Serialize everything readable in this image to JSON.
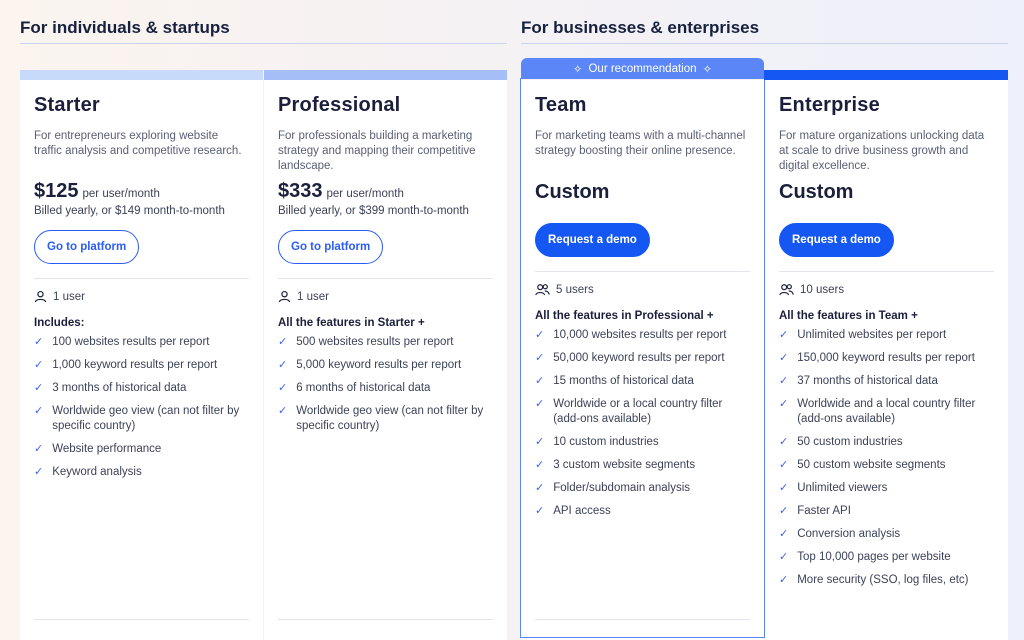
{
  "groups": {
    "individuals": "For individuals & startups",
    "businesses": "For businesses & enterprises"
  },
  "recommendation": "Our recommendation",
  "colors": {
    "accent": "#1557f2",
    "starter_bar": "#c8daf9",
    "professional_bar": "#a6bef7",
    "team_bar": "#5b86f7",
    "enterprise_bar": "#1557f2"
  },
  "plans": [
    {
      "name": "Starter",
      "description": "For entrepreneurs exploring website traffic analysis and competitive research.",
      "price": "$125",
      "price_unit": "per user/month",
      "billing": "Billed yearly, or $149 month-to-month",
      "button": "Go to platform",
      "users_icon": "user-icon",
      "users": "1 user",
      "includes": "Includes:",
      "features": [
        "100 websites results per report",
        "1,000 keyword results per report",
        "3 months of historical data",
        "Worldwide geo view (can not filter by specific country)",
        "Website performance",
        "Keyword analysis"
      ]
    },
    {
      "name": "Professional",
      "description": "For professionals building a marketing strategy and mapping their competitive landscape.",
      "price": "$333",
      "price_unit": "per user/month",
      "billing": "Billed yearly, or $399 month-to-month",
      "button": "Go to platform",
      "users_icon": "user-icon",
      "users": "1 user",
      "includes": "All the features in Starter +",
      "features": [
        "500 websites results per report",
        "5,000 keyword results per report",
        "6 months of historical data",
        "Worldwide geo view (can not filter by specific country)"
      ]
    },
    {
      "name": "Team",
      "description": "For marketing teams with a multi-channel strategy boosting their online presence.",
      "price": "Custom",
      "button": "Request a demo",
      "users_icon": "users-icon",
      "users": "5 users",
      "includes": "All the features in Professional +",
      "features": [
        "10,000 websites results per report",
        "50,000 keyword results per report",
        "15 months of historical data",
        "Worldwide or a local country filter (add-ons available)",
        "10 custom industries",
        "3 custom website segments",
        "Folder/subdomain analysis",
        "API access"
      ]
    },
    {
      "name": "Enterprise",
      "description": "For mature organizations unlocking data at scale to drive business growth and digital excellence.",
      "price": "Custom",
      "button": "Request a demo",
      "users_icon": "users-icon",
      "users": "10 users",
      "includes": "All the features in Team +",
      "features": [
        "Unlimited websites per report",
        "150,000 keyword results per report",
        "37 months of historical data",
        "Worldwide and a local country filter (add-ons available)",
        "50 custom industries",
        "50 custom website segments",
        "Unlimited viewers",
        "Faster API",
        "Conversion analysis",
        "Top 10,000 pages per website",
        "More security (SSO, log files, etc)"
      ]
    }
  ]
}
